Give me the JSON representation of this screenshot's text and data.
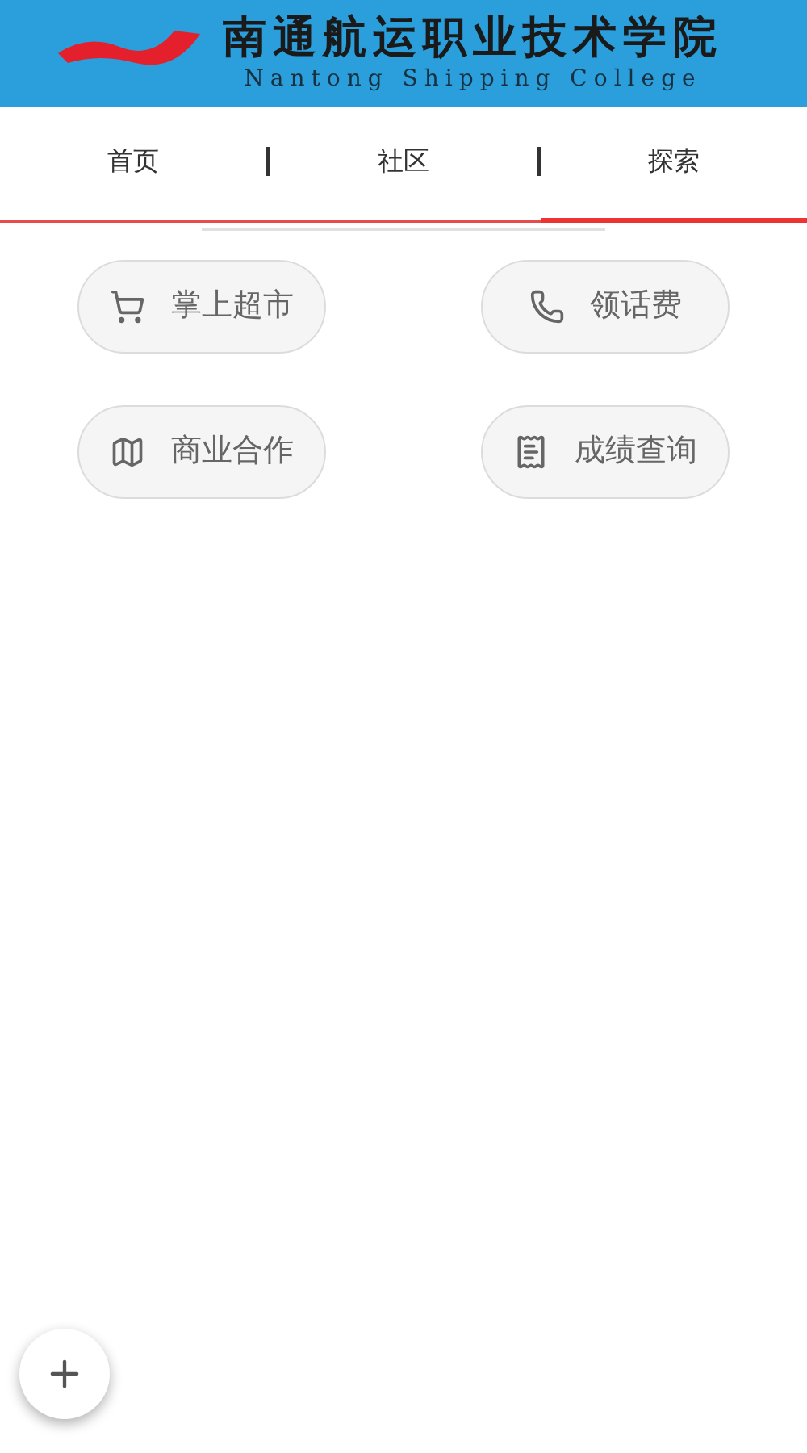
{
  "header": {
    "title": "南通航运职业技术学院",
    "subtitle": "Nantong Shipping College"
  },
  "tabs": [
    {
      "label": "首页",
      "selected": false
    },
    {
      "label": "社区",
      "selected": false
    },
    {
      "label": "探索",
      "selected": true
    }
  ],
  "shortcuts": [
    {
      "label": "掌上超市",
      "kind": "cart"
    },
    {
      "label": "领话费",
      "kind": "phone"
    },
    {
      "label": "商业合作",
      "kind": "map"
    },
    {
      "label": "成绩查询",
      "kind": "receipt"
    }
  ]
}
